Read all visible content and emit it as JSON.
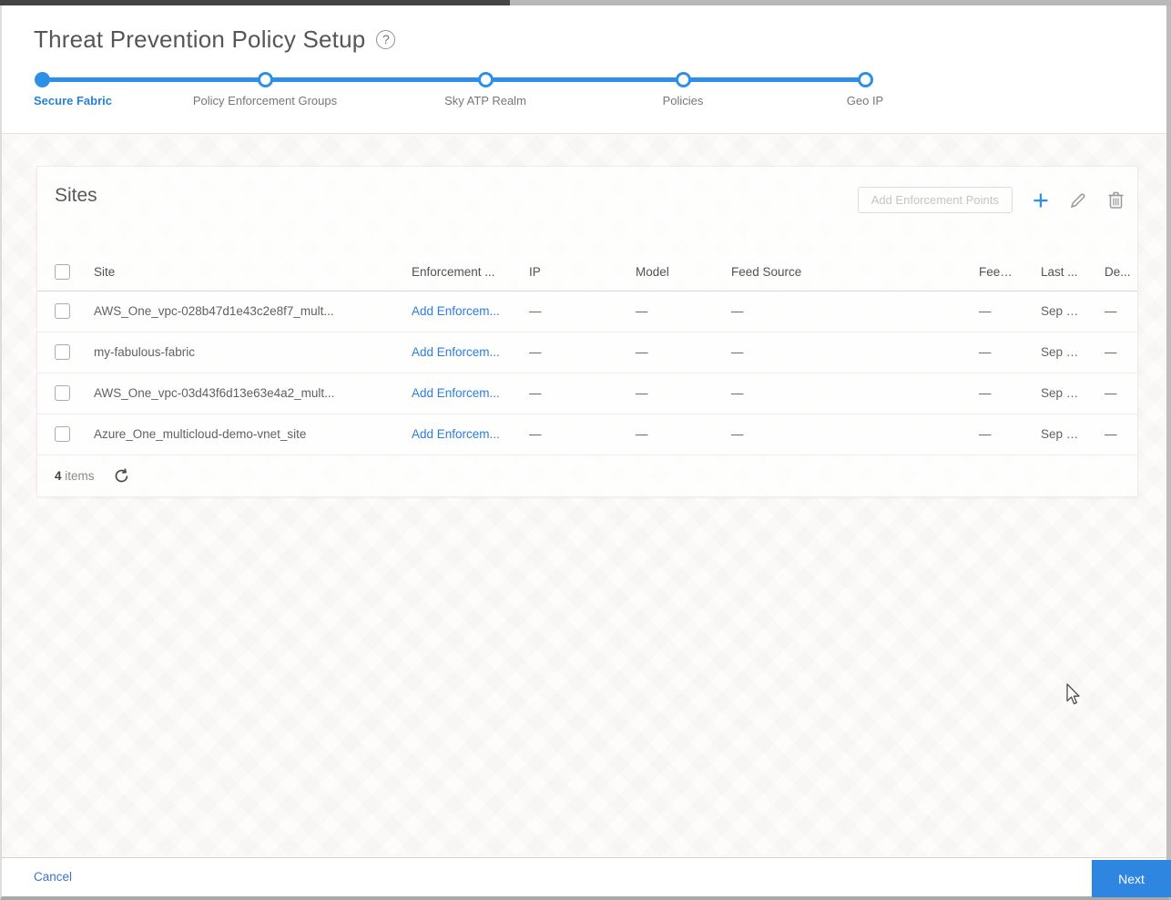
{
  "page": {
    "title": "Threat Prevention Policy Setup",
    "help_glyph": "?"
  },
  "stepper": {
    "steps": [
      {
        "label": "Secure Fabric",
        "state": "active"
      },
      {
        "label": "Policy Enforcement Groups",
        "state": "upcoming"
      },
      {
        "label": "Sky ATP Realm",
        "state": "upcoming"
      },
      {
        "label": "Policies",
        "state": "upcoming"
      },
      {
        "label": "Geo IP",
        "state": "upcoming"
      }
    ]
  },
  "panel": {
    "title": "Sites",
    "toolbar": {
      "add_enforcement_points_label": "Add Enforcement Points",
      "plus_glyph": "+"
    },
    "table": {
      "columns": [
        "Site",
        "Enforcement ...",
        "IP",
        "Model",
        "Feed Source",
        "Feed ...",
        "Last ...",
        "De..."
      ],
      "rows": [
        {
          "site": "AWS_One_vpc-028b47d1e43c2e8f7_mult...",
          "enforcement": "Add Enforcem...",
          "ip": "—",
          "model": "—",
          "feed_source": "—",
          "feed": "—",
          "last": "Sep 0...",
          "de": "—"
        },
        {
          "site": "my-fabulous-fabric",
          "enforcement": "Add Enforcem...",
          "ip": "—",
          "model": "—",
          "feed_source": "—",
          "feed": "—",
          "last": "Sep 0...",
          "de": "—"
        },
        {
          "site": "AWS_One_vpc-03d43f6d13e63e4a2_mult...",
          "enforcement": "Add Enforcem...",
          "ip": "—",
          "model": "—",
          "feed_source": "—",
          "feed": "—",
          "last": "Sep 0...",
          "de": "—"
        },
        {
          "site": "Azure_One_multicloud-demo-vnet_site",
          "enforcement": "Add Enforcem...",
          "ip": "—",
          "model": "—",
          "feed_source": "—",
          "feed": "—",
          "last": "Sep 0...",
          "de": "—"
        }
      ],
      "footer": {
        "count": "4",
        "items_label": "items"
      }
    }
  },
  "footer": {
    "cancel_label": "Cancel",
    "next_label": "Next"
  },
  "colors": {
    "accent_blue": "#2e8fe8",
    "link_blue": "#2b7de1",
    "next_button_blue": "#2e86e0",
    "step_label_gray": "#75777a",
    "title_gray": "#55565a"
  }
}
